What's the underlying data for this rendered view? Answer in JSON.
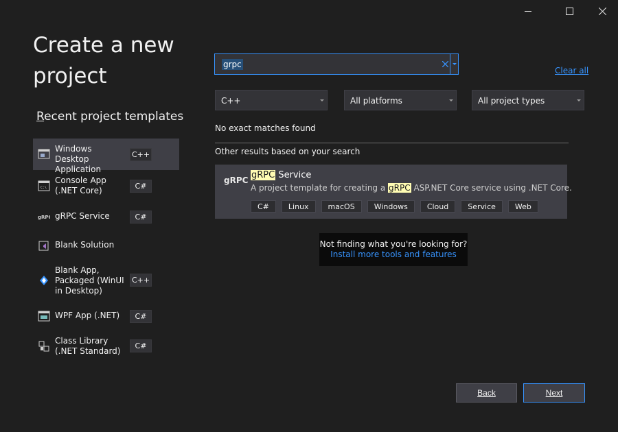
{
  "window": {
    "minimize_icon": "minimize-icon",
    "maximize_icon": "maximize-icon",
    "close_icon": "close-icon"
  },
  "page_title": "Create a new project",
  "recent": {
    "title_first": "R",
    "title_rest": "ecent project templates",
    "items": [
      {
        "label": "Windows Desktop Application",
        "lang": "C++",
        "icon": "windows-desktop-app-icon"
      },
      {
        "label": "Console App (.NET Core)",
        "lang": "C#",
        "icon": "console-app-icon"
      },
      {
        "label": "gRPC Service",
        "lang": "C#",
        "icon": "grpc-icon"
      },
      {
        "label": "Blank Solution",
        "lang": "",
        "icon": "blank-solution-icon"
      },
      {
        "label": "Blank App, Packaged (WinUI in Desktop)",
        "lang": "C++",
        "icon": "winui-app-icon"
      },
      {
        "label": "WPF App (.NET)",
        "lang": "C#",
        "icon": "wpf-app-icon"
      },
      {
        "label": "Class Library (.NET Standard)",
        "lang": "C#",
        "icon": "class-library-icon"
      }
    ]
  },
  "search": {
    "value": "grpc",
    "clear_icon": "close-icon",
    "dropdown_icon": "chevron-down-icon",
    "clear_all": "Clear all"
  },
  "filters": {
    "language": "C++",
    "platform": "All platforms",
    "project_type": "All project types"
  },
  "results": {
    "no_match": "No exact matches found",
    "other_results": "Other results based on your search",
    "card": {
      "logo": "gRPC",
      "title_highlight": "gRPC",
      "title_rest": " Service",
      "desc_before": "A project template for creating a ",
      "desc_highlight": "gRPC",
      "desc_after": " ASP.NET Core service using .NET Core.",
      "tags": [
        "C#",
        "Linux",
        "macOS",
        "Windows",
        "Cloud",
        "Service",
        "Web"
      ]
    }
  },
  "hint": {
    "text": "Not finding what you're looking for?",
    "link": "Install more tools and features"
  },
  "buttons": {
    "back": "Back",
    "next": "Next"
  },
  "colors": {
    "background": "#1f1f1f",
    "accent": "#3794ff",
    "card": "#3f3f46",
    "highlight": "#fffcb3"
  }
}
